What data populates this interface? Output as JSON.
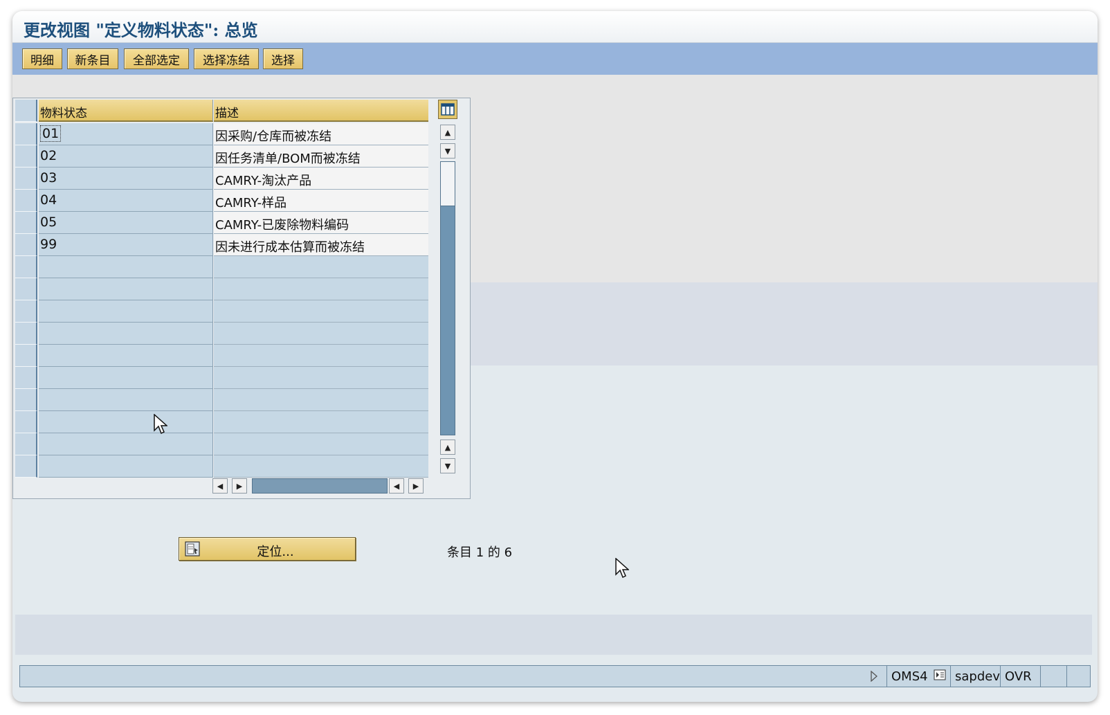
{
  "window": {
    "title": "更改视图 \"定义物料状态\": 总览"
  },
  "toolbar": {
    "buttons": [
      "明细",
      "新条目",
      "全部选定",
      "选择冻结",
      "选择"
    ]
  },
  "table": {
    "headers": [
      "物料状态",
      "描述"
    ],
    "rows": [
      {
        "status": "01",
        "desc": "因采购/仓库而被冻结"
      },
      {
        "status": "02",
        "desc": "因任务清单/BOM而被冻结"
      },
      {
        "status": "03",
        "desc": "CAMRY-淘汰产品"
      },
      {
        "status": "04",
        "desc": "CAMRY-样品"
      },
      {
        "status": "05",
        "desc": "CAMRY-已废除物料编码"
      },
      {
        "status": "99",
        "desc": "因未进行成本估算而被冻结"
      }
    ],
    "column_config_icon": "column-settings-icon"
  },
  "locate_button": {
    "label": "定位...",
    "icon": "locate-icon"
  },
  "entry_info": "条目 1 的 6",
  "statusbar": {
    "system": "OMS4",
    "server": "sapdev",
    "mode": "OVR"
  },
  "colors": {
    "toolbar_bg": "#97b4dc",
    "button_bg": "#e6c46a",
    "title_color": "#1d4f7c",
    "cell_key_bg": "#c6d8e5"
  }
}
